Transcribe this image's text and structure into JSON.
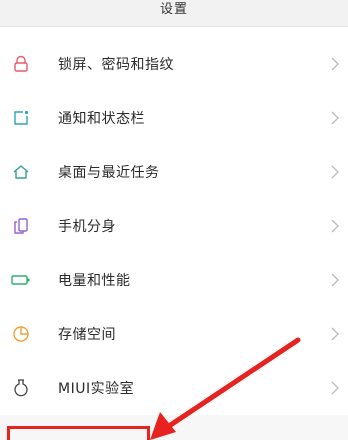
{
  "header": {
    "title": "设置"
  },
  "settings": {
    "items": [
      {
        "label": "锁屏、密码和指纹",
        "icon": "lock-icon",
        "color": "#e85a6a"
      },
      {
        "label": "通知和状态栏",
        "icon": "notification-icon",
        "color": "#2aa7b8"
      },
      {
        "label": "桌面与最近任务",
        "icon": "home-icon",
        "color": "#35a08f"
      },
      {
        "label": "手机分身",
        "icon": "dual-phone-icon",
        "color": "#9a62d0"
      },
      {
        "label": "电量和性能",
        "icon": "battery-icon",
        "color": "#2bb26a"
      },
      {
        "label": "存储空间",
        "icon": "storage-pie-icon",
        "color": "#f0a03a"
      },
      {
        "label": "MIUI实验室",
        "icon": "flask-icon",
        "color": "#444444"
      }
    ]
  },
  "colors": {
    "annotation": "#e8231f",
    "chevron": "#bdbdbd"
  }
}
